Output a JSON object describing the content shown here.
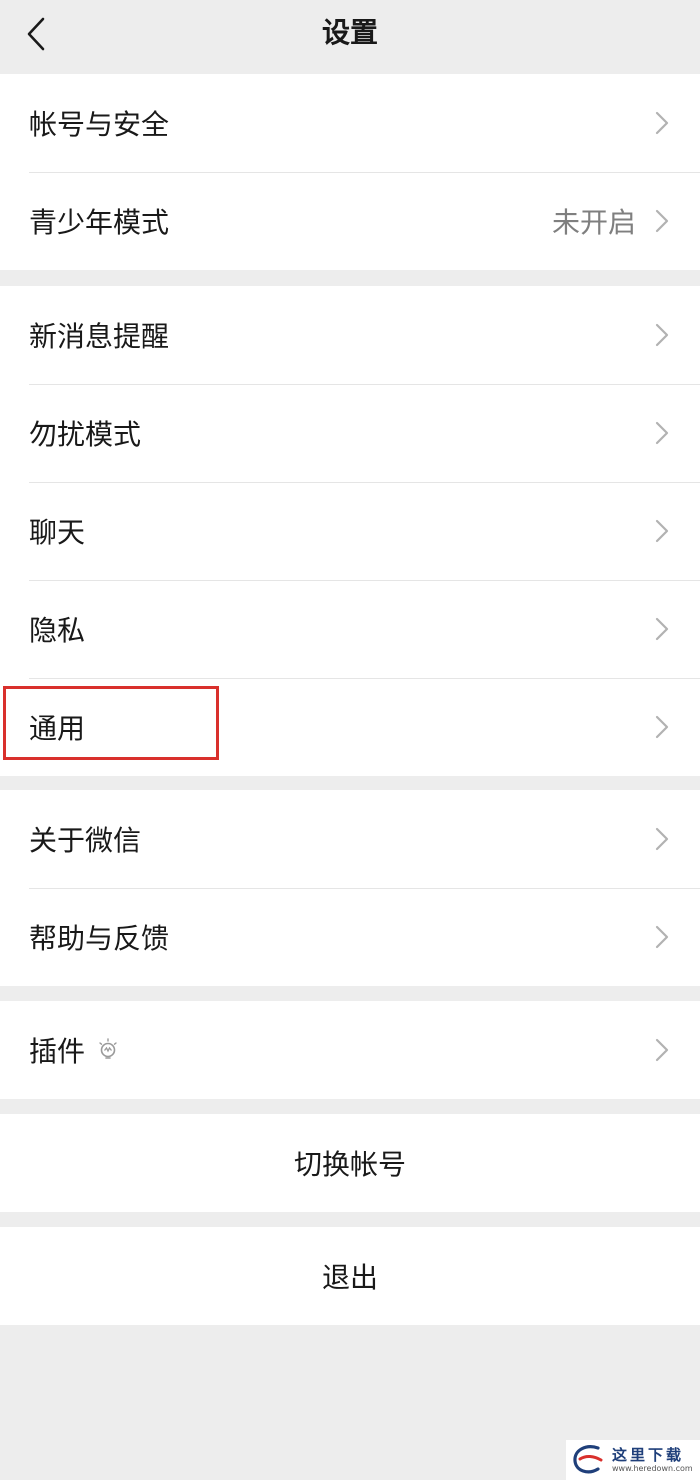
{
  "nav": {
    "title": "设置",
    "back_icon": "chevron-left-icon"
  },
  "groups": [
    {
      "items": [
        {
          "label": "帐号与安全",
          "value": ""
        },
        {
          "label": "青少年模式",
          "value": "未开启"
        }
      ]
    },
    {
      "items": [
        {
          "label": "新消息提醒",
          "value": ""
        },
        {
          "label": "勿扰模式",
          "value": ""
        },
        {
          "label": "聊天",
          "value": ""
        },
        {
          "label": "隐私",
          "value": ""
        },
        {
          "label": "通用",
          "value": "",
          "highlighted": true
        }
      ]
    },
    {
      "items": [
        {
          "label": "关于微信",
          "value": ""
        },
        {
          "label": "帮助与反馈",
          "value": ""
        }
      ]
    },
    {
      "items": [
        {
          "label": "插件",
          "value": "",
          "icon": "lightbulb-icon"
        }
      ]
    }
  ],
  "actions": {
    "switch_account": "切换帐号",
    "logout": "退出"
  },
  "colors": {
    "background": "#ededed",
    "card": "#ffffff",
    "text": "#191919",
    "secondary_text": "#7f7f7f",
    "highlight_border": "#d9302c"
  },
  "watermark": {
    "text_cn": "这里下载",
    "text_en": "www.heredown.com"
  }
}
